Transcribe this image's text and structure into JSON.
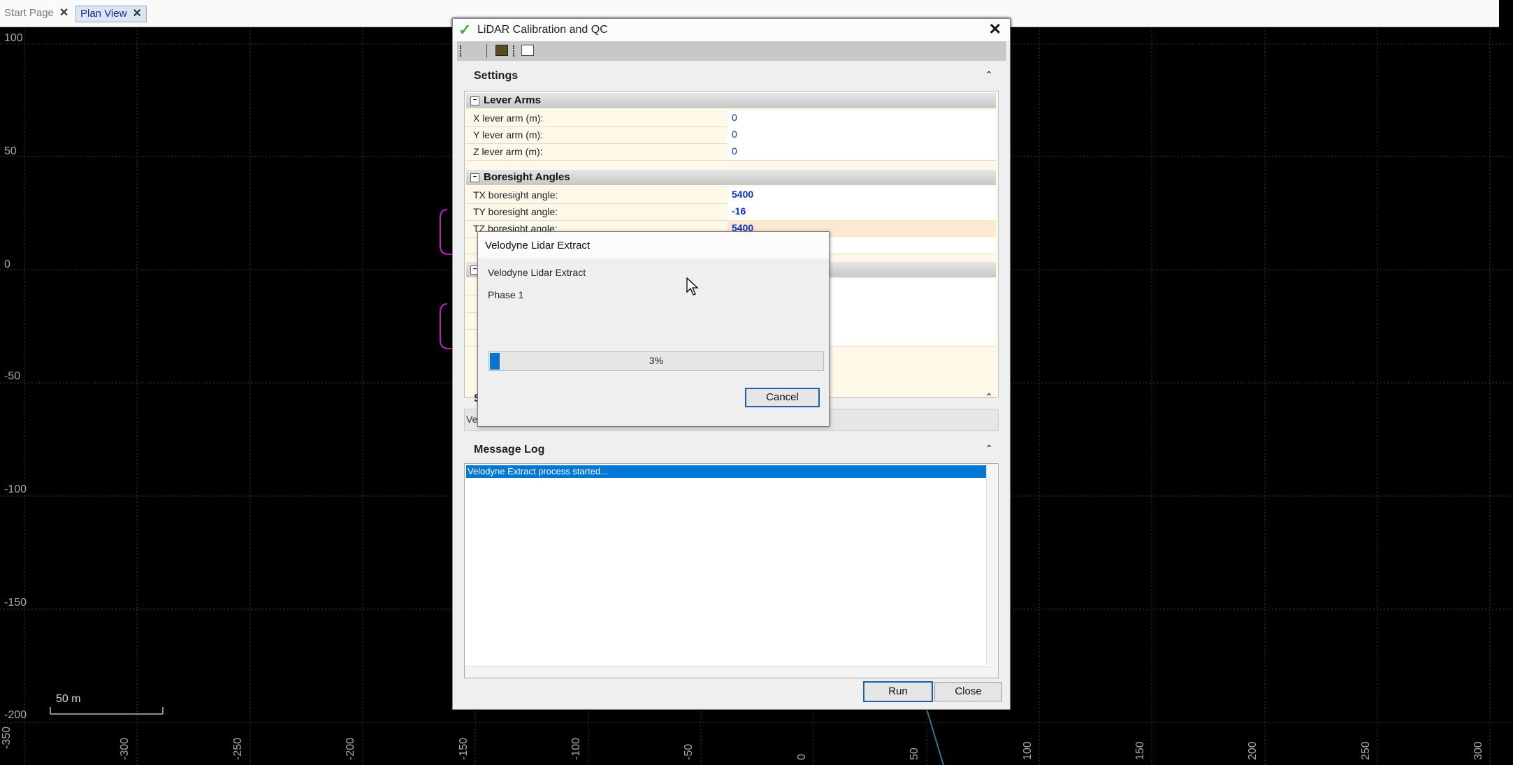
{
  "tabs": [
    {
      "label": "Start Page",
      "close": "✕"
    },
    {
      "label": "Plan View",
      "close": "✕"
    }
  ],
  "plot": {
    "y_ticks": [
      "100",
      "50",
      "0",
      "-50",
      "-100",
      "-150",
      "-200"
    ],
    "x_ticks": [
      "-350",
      "-300",
      "-250",
      "-200",
      "-150",
      "-100",
      "-50",
      "0",
      "50",
      "100",
      "150",
      "200",
      "250",
      "300"
    ],
    "scale_bar": "50 m"
  },
  "dialog": {
    "title": "LiDAR Calibration and QC",
    "close_glyph": "✕",
    "settings_header": "Settings",
    "lever_arms": {
      "label": "Lever Arms",
      "rows": [
        {
          "label": "X lever arm (m):",
          "value": "0"
        },
        {
          "label": "Y lever arm (m):",
          "value": "0"
        },
        {
          "label": "Z lever arm (m):",
          "value": "0"
        }
      ]
    },
    "boresight": {
      "label": "Boresight Angles",
      "rows": [
        {
          "label": "TX boresight angle:",
          "value": "5400"
        },
        {
          "label": "TY boresight angle:",
          "value": "-16"
        },
        {
          "label": "TZ boresight angle:",
          "value": "5400"
        }
      ]
    },
    "section3_partial": "S",
    "section3_content_partial": "Vel",
    "message_log": {
      "header": "Message Log",
      "lines": [
        "Velodyne Extract process started..."
      ]
    },
    "run_label": "Run",
    "close_label": "Close"
  },
  "progress": {
    "title": "Velodyne Lidar Extract",
    "task": "Velodyne Lidar Extract",
    "phase": "Phase 1",
    "percent_value": 0.03,
    "percent_text": "3%",
    "cancel_label": "Cancel"
  },
  "colors": {
    "background": "#000000",
    "grid": "#444444",
    "selection": "#0078d7",
    "progress_fill": "#0a74d2",
    "shape_outline": "#c020c0"
  }
}
